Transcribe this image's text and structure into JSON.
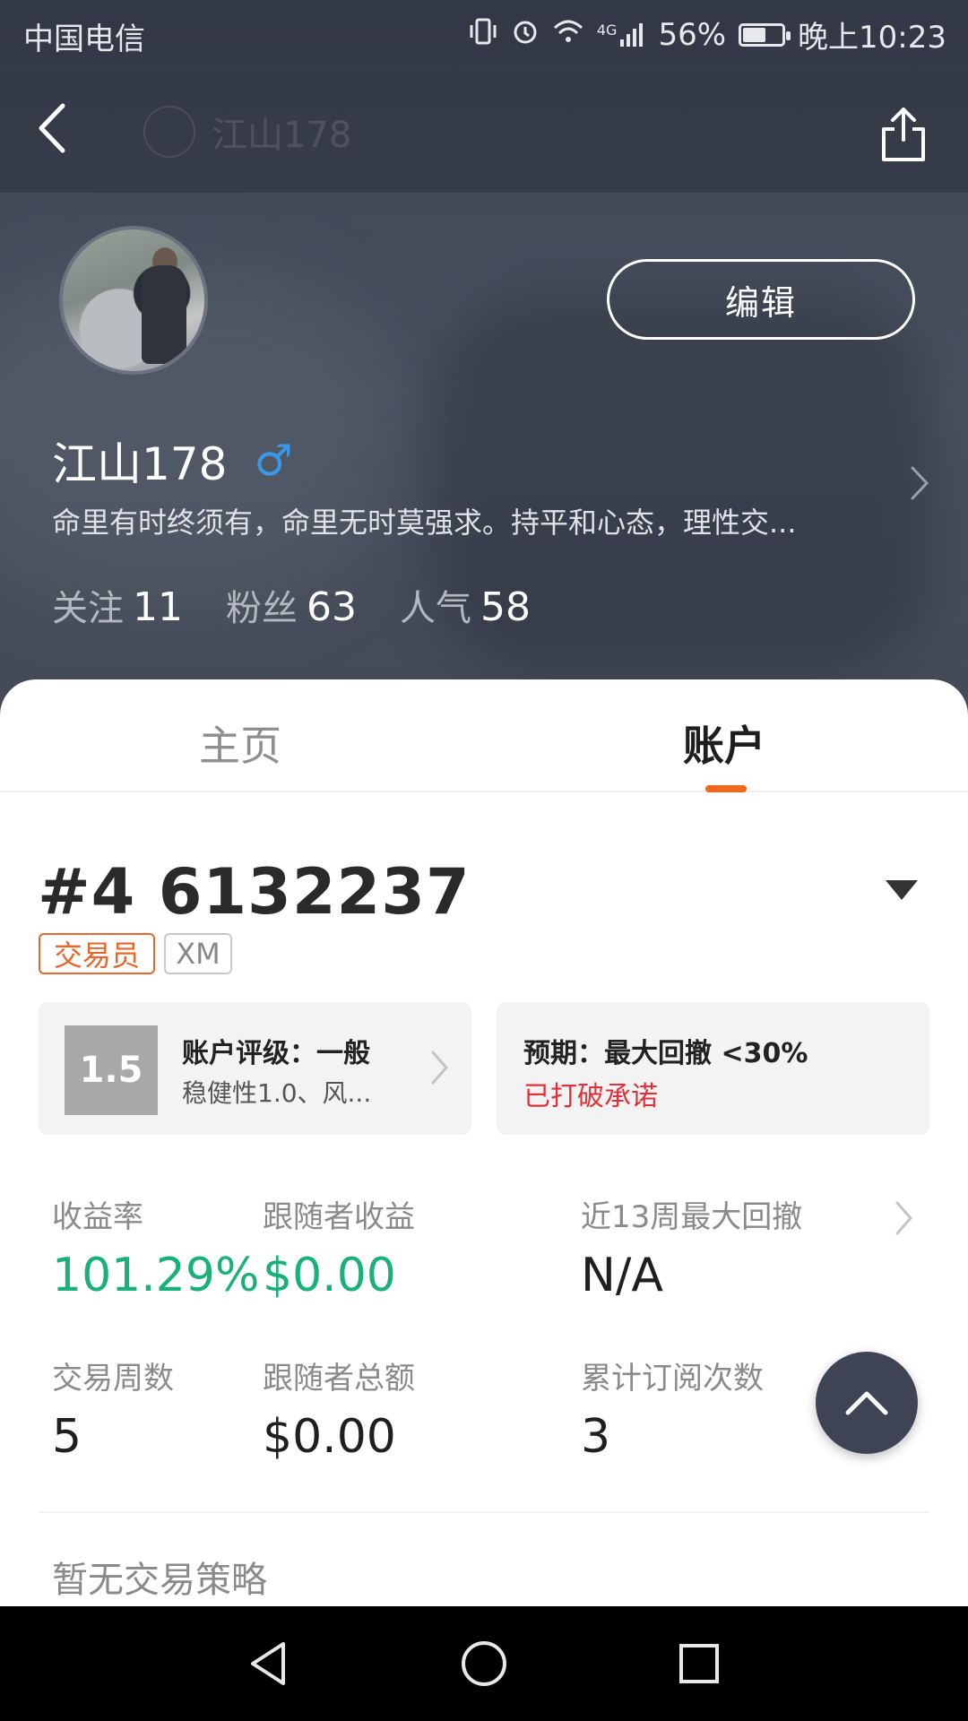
{
  "status_bar": {
    "carrier": "中国电信",
    "network": "4G",
    "battery": "56%",
    "battery_level": 0.56,
    "time": "晚上10:23",
    "icons": [
      "vibrate-icon",
      "alarm-icon",
      "wifi-icon",
      "signal-icon",
      "battery-icon"
    ]
  },
  "nav": {
    "title": "江山178",
    "back_icon": "back-arrow-icon",
    "share_icon": "share-icon"
  },
  "profile": {
    "username": "江山178",
    "gender_symbol": "♂",
    "bio": "命里有时终须有，命里无时莫强求。持平和心态，理性交...",
    "edit_label": "编辑",
    "stats": [
      {
        "label": "关注",
        "value": "11"
      },
      {
        "label": "粉丝",
        "value": "63"
      },
      {
        "label": "人气",
        "value": "58"
      }
    ]
  },
  "tabs": [
    {
      "label": "主页",
      "active": false
    },
    {
      "label": "账户",
      "active": true
    }
  ],
  "account": {
    "title": "#4 6132237",
    "tags": [
      "交易员",
      "XM"
    ],
    "rating": {
      "score": "1.5",
      "title": "账户评级：一般",
      "subtitle": "稳健性1.0、风..."
    },
    "expectation": {
      "title": "预期：最大回撤 <30%",
      "status": "已打破承诺"
    },
    "metrics": [
      {
        "label": "收益率",
        "value": "101.29%"
      },
      {
        "label": "跟随者收益",
        "value": "$0.00"
      },
      {
        "label": "近13周最大回撤",
        "value": "N/A"
      },
      {
        "label": "交易周数",
        "value": "5"
      },
      {
        "label": "跟随者总额",
        "value": "$0.00"
      },
      {
        "label": "累计订阅次数",
        "value": "3"
      }
    ],
    "no_strategy": "暂无交易策略"
  },
  "colors": {
    "accent_orange": "#f0671e",
    "positive_green": "#19b07a",
    "warning_red": "#e0303a"
  }
}
